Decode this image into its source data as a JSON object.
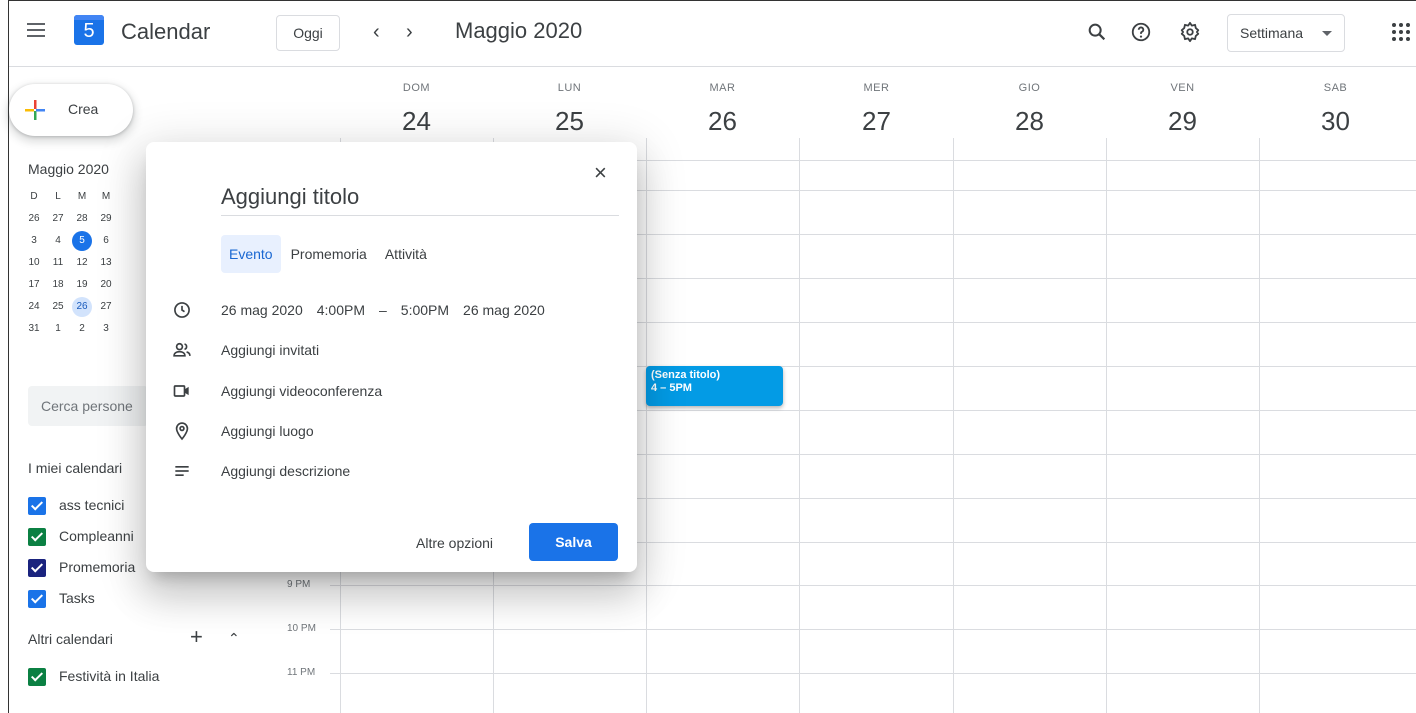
{
  "header": {
    "app_title": "Calendar",
    "logo_day": "5",
    "today_label": "Oggi",
    "prev_label": "‹",
    "next_label": "›",
    "month_title": "Maggio 2020",
    "view_label": "Settimana"
  },
  "sidebar": {
    "create_label": "Crea",
    "mini_title": "Maggio 2020",
    "mini_headers": [
      "D",
      "L",
      "M",
      "M"
    ],
    "mini_rows": [
      [
        "26",
        "27",
        "28",
        "29"
      ],
      [
        "3",
        "4",
        "5",
        "6"
      ],
      [
        "10",
        "11",
        "12",
        "13"
      ],
      [
        "17",
        "18",
        "19",
        "20"
      ],
      [
        "24",
        "25",
        "26",
        "27"
      ],
      [
        "31",
        "1",
        "2",
        "3"
      ]
    ],
    "search_placeholder": "Cerca persone",
    "my_calendars_title": "I miei calendari",
    "my_calendars": [
      {
        "label": "ass tecnici",
        "color": "#1a73e8"
      },
      {
        "label": "Compleanni",
        "color": "#0b8043"
      },
      {
        "label": "Promemoria",
        "color": "#1a237e"
      },
      {
        "label": "Tasks",
        "color": "#1a73e8"
      }
    ],
    "other_calendars_title": "Altri calendari",
    "other_plus": "+",
    "other_chevron": "⌃",
    "other_calendars": [
      {
        "label": "Festività in Italia",
        "color": "#0b8043"
      }
    ]
  },
  "week": {
    "days": [
      {
        "name": "DOM",
        "num": "24"
      },
      {
        "name": "LUN",
        "num": "25"
      },
      {
        "name": "MAR",
        "num": "26"
      },
      {
        "name": "MER",
        "num": "27"
      },
      {
        "name": "GIO",
        "num": "28"
      },
      {
        "name": "VEN",
        "num": "29"
      },
      {
        "name": "SAB",
        "num": "30"
      }
    ],
    "time_labels": [
      "9 PM",
      "10 PM",
      "11 PM"
    ]
  },
  "event": {
    "title": "(Senza titolo)",
    "time": "4 – 5PM",
    "color": "#039be5"
  },
  "dialog": {
    "close": "×",
    "title_placeholder": "Aggiungi titolo",
    "tabs": [
      "Evento",
      "Promemoria",
      "Attività"
    ],
    "start_date": "26 mag 2020",
    "start_time": "4:00PM",
    "dash": "–",
    "end_time": "5:00PM",
    "end_date": "26 mag 2020",
    "add_guests": "Aggiungi invitati",
    "add_video": "Aggiungi videoconferenza",
    "add_location": "Aggiungi luogo",
    "add_description": "Aggiungi descrizione",
    "more_options": "Altre opzioni",
    "save": "Salva"
  }
}
